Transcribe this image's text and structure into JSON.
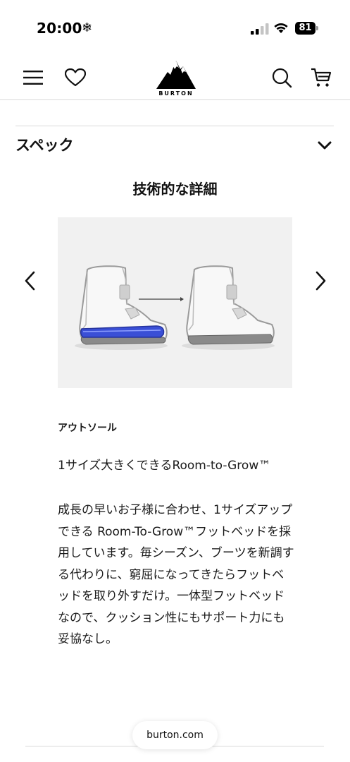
{
  "status_bar": {
    "time": "20:00",
    "weather_glyph": "❄",
    "battery_level": "81",
    "signal_bars_active": 2,
    "signal_bars_total": 4
  },
  "header": {
    "brand": "BURTON",
    "icons": [
      "menu-icon",
      "heart-icon",
      "burton-logo",
      "search-icon",
      "cart-icon"
    ]
  },
  "spec": {
    "title": "スペック",
    "expanded": true
  },
  "section": {
    "title": "技術的な詳細"
  },
  "carousel": {
    "image_description_icon": "boot-footbed-diagram",
    "accent_color": "#3a4fd6"
  },
  "feature": {
    "label": "アウトソール",
    "heading": "1サイズ大きくできるRoom-to-Grow™",
    "body": "成長の早いお子様に合わせ、1サイズアップできる Room-To-Grow™フットベッドを採用しています。毎シーズン、ブーツを新調する代わりに、窮屈になってきたらフットベッドを取り外すだけ。一体型フットベッドなので、クッション性にもサポート力にも妥協なし。"
  },
  "browser": {
    "url": "burton.com"
  }
}
